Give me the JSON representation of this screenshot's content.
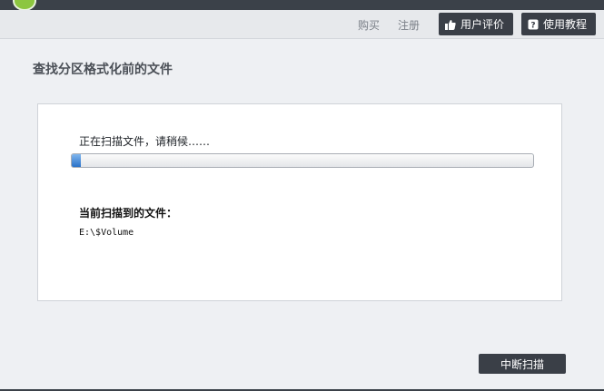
{
  "header": {
    "buy_link": "购买",
    "register_link": "注册",
    "reviews_button": "用户评价",
    "tutorial_button": "使用教程"
  },
  "page": {
    "title": "查找分区格式化前的文件"
  },
  "scan": {
    "status_text": "正在扫描文件，请稍候……",
    "progress_fraction": 0.01,
    "current_label": "当前扫描到的文件：",
    "current_file": "E:\\$Volume"
  },
  "actions": {
    "stop_scan": "中断扫描"
  },
  "colors": {
    "dark_button": "#3a3f47",
    "progress_fill": "#2a72c8",
    "logo": "#8cc63f"
  }
}
